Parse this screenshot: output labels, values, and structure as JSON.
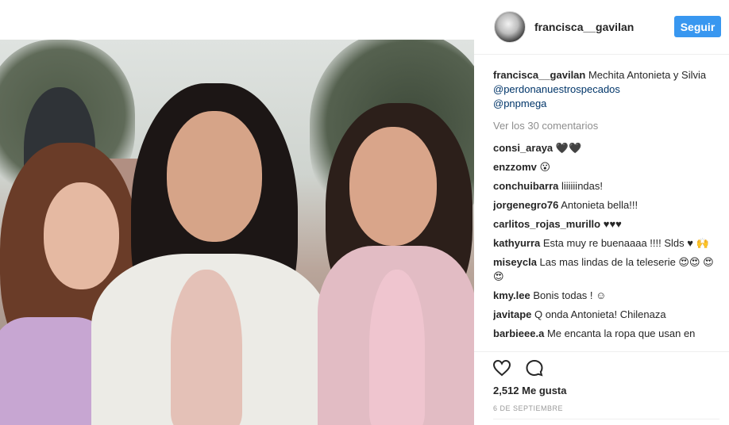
{
  "post": {
    "username": "francisca__gavilan",
    "follow_label": "Seguir",
    "caption": {
      "username": "francisca__gavilan",
      "text": " Mechita Antonieta y Silvia ",
      "mention1": "@perdonanuestrospecados",
      "mention2": "@pnpmega"
    },
    "view_all": "Ver los 30 comentarios",
    "comments": [
      {
        "user": "consi_araya",
        "text": " 🖤🖤"
      },
      {
        "user": "enzzomv",
        "text": " 😮"
      },
      {
        "user": "conchuibarra",
        "text": " liiiiiindas!"
      },
      {
        "user": "jorgenegro76",
        "text": " Antonieta bella!!!"
      },
      {
        "user": "carlitos_rojas_murillo",
        "text": " ♥♥♥"
      },
      {
        "user": "kathyurra",
        "text": " Esta muy re buenaaaa !!!! Slds ♥ 🙌"
      },
      {
        "user": "miseycla",
        "text": " Las mas lindas de la teleserie 😍😍 😍😍"
      },
      {
        "user": "kmy.lee",
        "text": " Bonis todas ! ☺"
      },
      {
        "user": "javitape",
        "text": " Q onda Antonieta! Chilenaza"
      },
      {
        "user": "barbieee.a",
        "text": " Me encanta la ropa que usan en"
      }
    ],
    "likes": "2,512 Me gusta",
    "date": "6 DE SEPTIEMBRE"
  },
  "icons": {
    "heart": "heart-icon",
    "comment": "comment-icon"
  },
  "colors": {
    "accent": "#3897f0",
    "mention": "#003569",
    "muted": "#8e8e8e"
  }
}
